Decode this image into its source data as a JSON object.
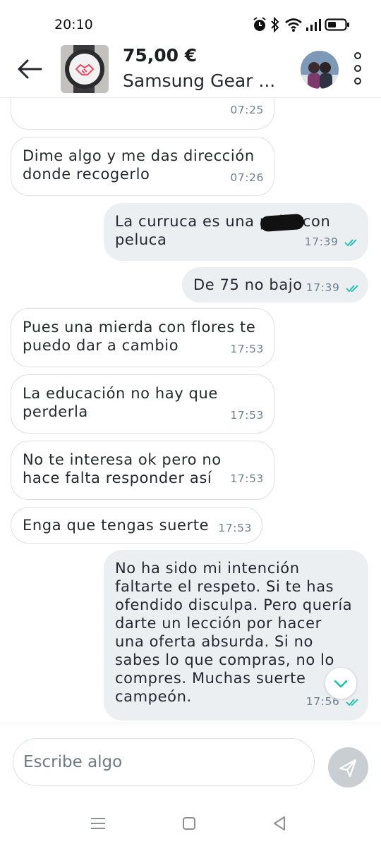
{
  "status_bar": {
    "time": "20:10",
    "icons": [
      "alarm-icon",
      "bluetooth-icon",
      "wifi-icon",
      "signal-icon",
      "battery-icon"
    ]
  },
  "header": {
    "price": "75,00 €",
    "product_name": "Samsung Gear ...",
    "thumbnail_icon": "handshake-icon",
    "accent_color": "#e8536a"
  },
  "messages": [
    {
      "direction": "in",
      "text": "",
      "time": "07:25"
    },
    {
      "direction": "in",
      "text": "Dime algo y me das dirección donde recogerlo",
      "time": "07:26"
    },
    {
      "direction": "out",
      "text": "La curruca es una polla con peluca",
      "time": "17:39",
      "status": "read"
    },
    {
      "direction": "out",
      "text": "De 75 no bajo",
      "time": "17:39",
      "status": "read"
    },
    {
      "direction": "in",
      "text": "Pues una mierda con flores te puedo dar a cambio",
      "time": "17:53"
    },
    {
      "direction": "in",
      "text": "La educación no hay que perderla",
      "time": "17:53"
    },
    {
      "direction": "in",
      "text": "No te interesa ok pero no hace falta responder así",
      "time": "17:53"
    },
    {
      "direction": "in",
      "text": "Enga que tengas suerte",
      "time": "17:53"
    },
    {
      "direction": "out",
      "text": "No ha sido mi intención faltarte el respeto. Si te has ofendido disculpa. Pero quería darte un lección por hacer una oferta absurda. Si no sabes lo que compras, no lo compres.  Muchas suerte campeón.",
      "time": "17:56",
      "status": "read"
    }
  ],
  "composer": {
    "placeholder": "Escribe algo"
  },
  "colors": {
    "read_ticks": "#13c1ac",
    "outgoing_bubble": "#eceff1",
    "send_button": "#c9ced2"
  }
}
